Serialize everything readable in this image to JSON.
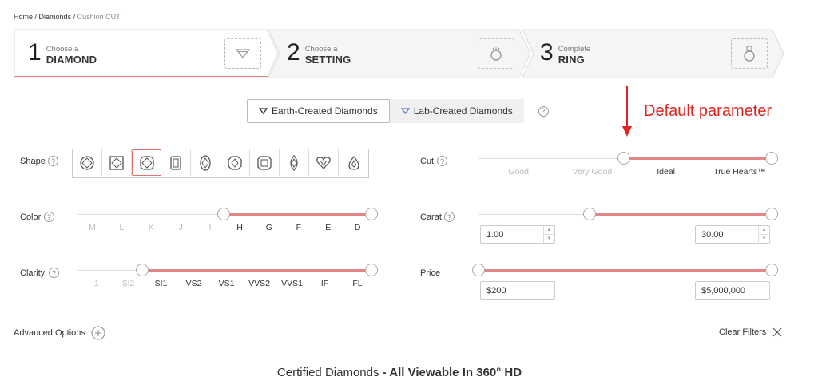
{
  "breadcrumb": {
    "home": "Home",
    "sep1": " / ",
    "diamonds": "Diamonds",
    "sep2": " / ",
    "current": "Cushion CUT"
  },
  "steps": [
    {
      "num": "1",
      "sub": "Choose a",
      "main": "DIAMOND",
      "icon": "diamond-icon"
    },
    {
      "num": "2",
      "sub": "Choose a",
      "main": "SETTING",
      "icon": "ring-setting-icon"
    },
    {
      "num": "3",
      "sub": "Complete",
      "main": "RING",
      "icon": "ring-icon"
    }
  ],
  "toggle": {
    "earth": "Earth-Created Diamonds",
    "lab": "Lab-Created Diamonds",
    "help": "?"
  },
  "annotation": "Default parameter",
  "colors": {
    "accent": "#e28686",
    "annotation": "#e0231f"
  },
  "shape": {
    "label": "Shape",
    "help": "?",
    "options": [
      "round",
      "princess",
      "cushion",
      "radiant",
      "oval",
      "asscher",
      "emerald",
      "marquise",
      "heart",
      "pear"
    ],
    "selected": "cushion"
  },
  "color": {
    "label": "Color",
    "help": "?",
    "ticks": [
      "M",
      "L",
      "K",
      "J",
      "I",
      "H",
      "G",
      "F",
      "E",
      "D"
    ],
    "selected_from": "H",
    "selected_to": "D"
  },
  "clarity": {
    "label": "Clarity",
    "help": "?",
    "ticks": [
      "I1",
      "SI2",
      "SI1",
      "VS2",
      "VS1",
      "VVS2",
      "VVS1",
      "IF",
      "FL"
    ],
    "selected_from": "SI1",
    "selected_to": "FL"
  },
  "cut": {
    "label": "Cut",
    "help": "?",
    "ticks": [
      "Good",
      "Very Good",
      "Ideal",
      "True Hearts™"
    ],
    "selected_from": "Ideal",
    "selected_to": "True Hearts™"
  },
  "carat": {
    "label": "Carat",
    "help": "?",
    "min": "1.00",
    "max": "30.00"
  },
  "price": {
    "label": "Price",
    "min": "$200",
    "max": "$5,000,000"
  },
  "advanced": {
    "label": "Advanced Options"
  },
  "clear": {
    "label": "Clear Filters"
  },
  "footer": {
    "normal": "Certified Diamonds",
    "dash": " - ",
    "bold": "All Viewable In 360° HD"
  }
}
